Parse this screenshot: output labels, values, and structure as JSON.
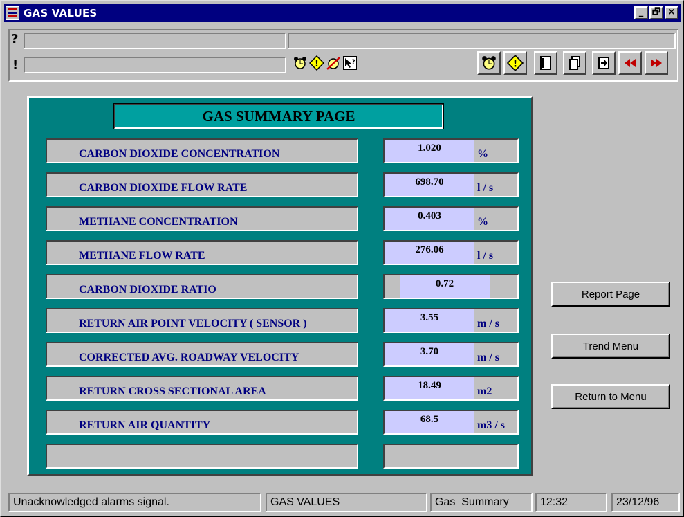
{
  "window": {
    "title": "GAS VALUES",
    "controls": [
      "_",
      "🗗",
      "×"
    ]
  },
  "info": {
    "question_mark": "?",
    "exclamation_mark": "!",
    "field_1": "",
    "field_2": "",
    "field_3": ""
  },
  "toolbar": {
    "small_icons": [
      "alarm-clock-icon",
      "warning-diamond-icon",
      "alarm-disabled-icon",
      "help-pointer-icon"
    ],
    "buttons": [
      "alarm-clock-icon",
      "warning-diamond-icon",
      "page-icon",
      "pages-icon",
      "page-exit-icon",
      "previous-icon",
      "next-icon"
    ]
  },
  "panel": {
    "title": "GAS SUMMARY PAGE",
    "rows": [
      {
        "label": "CARBON DIOXIDE CONCENTRATION",
        "value": "1.020",
        "unit": "%"
      },
      {
        "label": "CARBON DIOXIDE FLOW RATE",
        "value": "698.70",
        "unit": "l / s"
      },
      {
        "label": "METHANE CONCENTRATION",
        "value": "0.403",
        "unit": "%"
      },
      {
        "label": "METHANE FLOW RATE",
        "value": "276.06",
        "unit": "l / s"
      },
      {
        "label": "CARBON DIOXIDE RATIO",
        "value": "0.72",
        "unit": ""
      },
      {
        "label": "RETURN AIR POINT VELOCITY  ( SENSOR )",
        "value": "3.55",
        "unit": "m / s"
      },
      {
        "label": "CORRECTED AVG. ROADWAY  VELOCITY",
        "value": "3.70",
        "unit": "m / s"
      },
      {
        "label": "RETURN CROSS SECTIONAL AREA",
        "value": "18.49",
        "unit": "m2"
      },
      {
        "label": "RETURN AIR QUANTITY",
        "value": "68.5",
        "unit": "m3 / s"
      },
      {
        "label": "",
        "value": "",
        "unit": ""
      }
    ]
  },
  "side_buttons": {
    "report": "Report Page",
    "trend": "Trend Menu",
    "return": "Return to Menu"
  },
  "statusbar": {
    "message": "Unacknowledged alarms signal.",
    "screen": "GAS VALUES",
    "page": "Gas_Summary",
    "time": "12:32",
    "date": "23/12/96"
  },
  "colors": {
    "title_bar": "#000080",
    "panel_bg": "#008080",
    "panel_title_bg": "#00a0a0",
    "label_text": "#000080",
    "value_box": "#ccccff",
    "chrome": "#c0c0c0"
  }
}
